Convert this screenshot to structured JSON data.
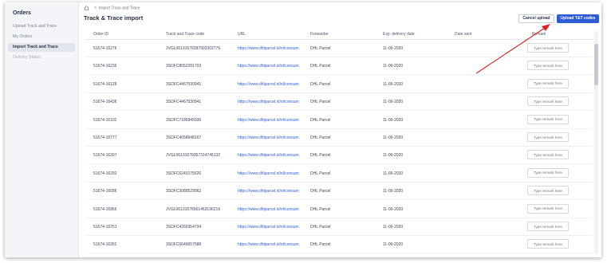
{
  "sidebar": {
    "title": "Orders",
    "items": [
      {
        "label": "Upload Track and Trace",
        "state": "normal"
      },
      {
        "label": "My Orders",
        "state": "normal"
      },
      {
        "label": "Import Track and Trace",
        "state": "active"
      },
      {
        "label": "Delivery Status",
        "state": "dim"
      }
    ]
  },
  "breadcrumb": {
    "icon": "home-icon",
    "separator": ">",
    "current": "Import Track and Trace"
  },
  "page_title": "Track & Trace import",
  "buttons": {
    "cancel": "Cancel upload",
    "upload": "Upload T&T codes"
  },
  "table": {
    "headers": [
      "Order ID",
      "Track and Trace code",
      "URL",
      "Forwarder",
      "Exp. delivery date",
      "Date sent",
      "Remark"
    ],
    "remark_placeholder": "Type remark here",
    "rows": [
      {
        "order": "51674-16276",
        "code": "JVGL06131676287903302776",
        "url": "https://www.dhlparcel.nl/nl/consum",
        "fwd": "DHL Parcel",
        "date": "11-06-2020",
        "sent": ""
      },
      {
        "order": "51674-16239",
        "code": "3SDFC8052281703",
        "url": "https://www.dhlparcel.nl/nl/consum",
        "fwd": "DHL Parcel",
        "date": "11-06-2020",
        "sent": ""
      },
      {
        "order": "51674-16128",
        "code": "3SDFC4467530941",
        "url": "https://www.dhlparcel.nl/nl/consum",
        "fwd": "DHL Parcel",
        "date": "11-06-2020",
        "sent": ""
      },
      {
        "order": "51674-16436",
        "code": "3SDFC4467530941",
        "url": "https://www.dhlparcel.nl/nl/consum",
        "fwd": "DHL Parcel",
        "date": "11-06-2020",
        "sent": ""
      },
      {
        "order": "51674-16102",
        "code": "3SDFC7185945936",
        "url": "https://www.dhlparcel.nl/nl/consum",
        "fwd": "DHL Parcel",
        "date": "11-06-2020",
        "sent": ""
      },
      {
        "order": "51674-16777",
        "code": "3SDFC4058948167",
        "url": "https://www.dhlparcel.nl/nl/consum",
        "fwd": "DHL Parcel",
        "date": "11-06-2020",
        "sent": ""
      },
      {
        "order": "51674-16307",
        "code": "JVGL06131676057314745132",
        "url": "https://www.dhlparcel.nl/nl/consum",
        "fwd": "DHL Parcel",
        "date": "11-06-2020",
        "sent": ""
      },
      {
        "order": "51674-16293",
        "code": "3SDFC6243175626",
        "url": "https://www.dhlparcel.nl/nl/consum",
        "fwd": "DHL Parcel",
        "date": "11-06-2020",
        "sent": ""
      },
      {
        "order": "51674-16096",
        "code": "3SDFC3089529962",
        "url": "https://www.dhlparcel.nl/nl/consum",
        "fwd": "DHL Parcel",
        "date": "11-06-2020",
        "sent": ""
      },
      {
        "order": "51674-16956",
        "code": "JVGL06131676561463196216",
        "url": "https://www.dhlparcel.nl/nl/consum",
        "fwd": "DHL Parcel",
        "date": "11-06-2020",
        "sent": ""
      },
      {
        "order": "51674-16751",
        "code": "3SDFC4260354734",
        "url": "https://www.dhlparcel.nl/nl/consum",
        "fwd": "DHL Parcel",
        "date": "11-06-2020",
        "sent": ""
      },
      {
        "order": "51674-16350",
        "code": "3SDFC6649657588",
        "url": "https://www.dhlparcel.nl/nl/consum",
        "fwd": "DHL Parcel",
        "date": "11-06-2020",
        "sent": ""
      }
    ]
  },
  "colors": {
    "accent": "#2f5bd6",
    "arrow": "#e02020",
    "sidebar_bg": "#f4f5f8"
  }
}
